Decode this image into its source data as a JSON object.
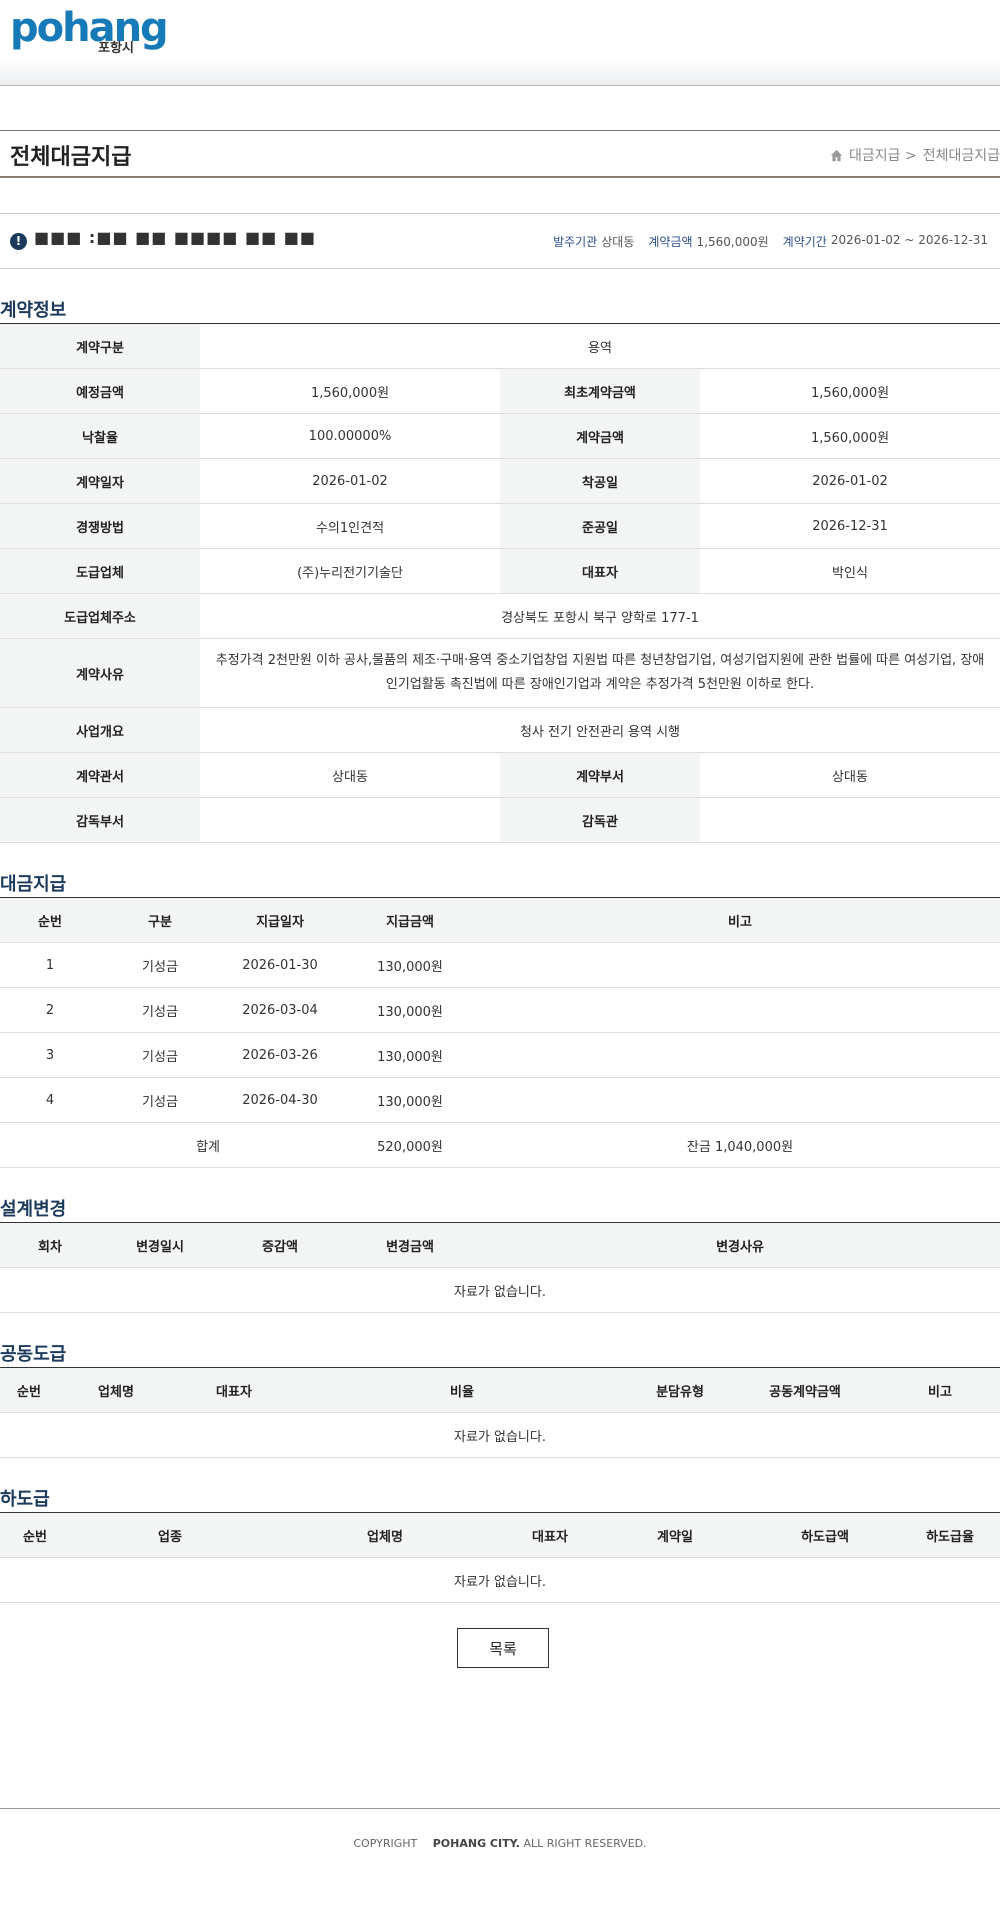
{
  "header": {
    "logo_word": "pohang",
    "logo_sub": "포항시"
  },
  "page": {
    "title": "전체대금지급",
    "breadcrumb": [
      "대금지급 >",
      "전체대금지급"
    ]
  },
  "summary": {
    "name": "■■■ :■■ ■■ ■■■■ ■■ ■■",
    "org_label": "발주기관",
    "org_value": "상대동",
    "amount_label": "계약금액",
    "amount_value": "1,560,000원",
    "period_label": "계약기간",
    "period_value": "2026-01-02 ~ 2026-12-31"
  },
  "contract": {
    "title": "계약정보",
    "type_label": "계약구분",
    "type_value": "용역",
    "est_label": "예정금액",
    "est_value": "1,560,000원",
    "first_label": "최초계약금액",
    "first_value": "1,560,000원",
    "rate_label": "낙찰율",
    "rate_value": "100.00000%",
    "amount_label": "계약금액",
    "amount_value": "1,560,000원",
    "date_label": "계약일자",
    "date_value": "2026-01-02",
    "start_label": "착공일",
    "start_value": "2026-01-02",
    "method_label": "경쟁방법",
    "method_value": "수의1인견적",
    "end_label": "준공일",
    "end_value": "2026-12-31",
    "vendor_label": "도급업체",
    "vendor_value": "(주)누리전기기술단",
    "ceo_label": "대표자",
    "ceo_value": "박인식",
    "addr_label": "도급업체주소",
    "addr_value": "경상북도 포항시 북구 양학로 177-1",
    "reason_label": "계약사유",
    "reason_value": "추정가격 2천만원 이하 공사,물품의 제조·구매·용역 중소기업창업 지원법 따른 청년창업기업, 여성기업지원에 관한 법률에 따른 여성기업, 장애인기업활동 촉진법에 따른 장애인기업과 계약은 추정가격 5천만원 이하로 한다.",
    "summary_label": "사업개요",
    "summary_value": "청사 전기 안전관리 용역 시행",
    "office_label": "계약관서",
    "office_value": "상대동",
    "dept_label": "계약부서",
    "dept_value": "상대동",
    "sup_dept_label": "감독부서",
    "sup_dept_value": "",
    "supervisor_label": "감독관",
    "supervisor_value": ""
  },
  "payment": {
    "title": "대금지급",
    "headers": [
      "순번",
      "구분",
      "지급일자",
      "지급금액",
      "비고"
    ],
    "rows": [
      [
        "1",
        "기성금",
        "2026-01-30",
        "130,000원",
        ""
      ],
      [
        "2",
        "기성금",
        "2026-03-04",
        "130,000원",
        ""
      ],
      [
        "3",
        "기성금",
        "2026-03-26",
        "130,000원",
        ""
      ],
      [
        "4",
        "기성금",
        "2026-04-30",
        "130,000원",
        ""
      ]
    ],
    "total_label": "합계",
    "total_value": "520,000원",
    "balance": "잔금 1,040,000원"
  },
  "design_change": {
    "title": "설계변경",
    "headers": [
      "회차",
      "변경일시",
      "증감액",
      "변경금액",
      "변경사유"
    ],
    "empty": "자료가 없습니다."
  },
  "joint": {
    "title": "공동도급",
    "headers": [
      "순번",
      "업체명",
      "대표자",
      "비율",
      "분담유형",
      "공동계약금액",
      "비고"
    ],
    "empty": "자료가 없습니다."
  },
  "subcontract": {
    "title": "하도급",
    "headers": [
      "순번",
      "업종",
      "업체명",
      "대표자",
      "계약일",
      "하도급액",
      "하도급율"
    ],
    "empty": "자료가 없습니다."
  },
  "buttons": {
    "list": "목록"
  },
  "footer": {
    "copyright": "COPYRIGHT",
    "org": "POHANG CITY.",
    "rights": "ALL RIGHT RESERVED."
  }
}
